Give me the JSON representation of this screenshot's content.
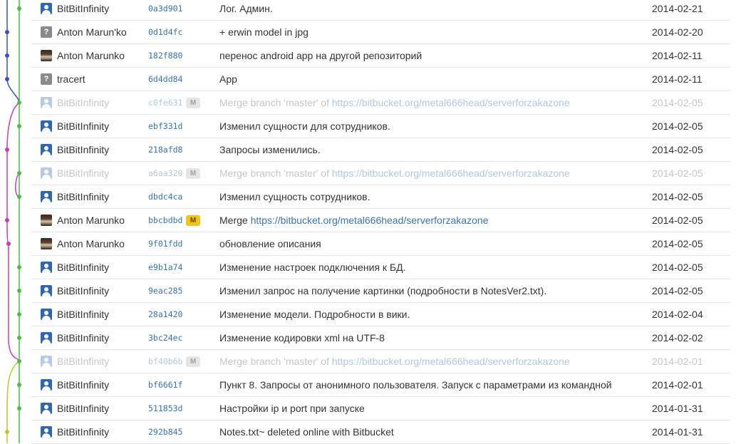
{
  "graph": {
    "colors": {
      "green": "#49bf4a",
      "blue": "#3a4fc1",
      "magenta": "#c23fb8",
      "olive": "#c4c43a"
    }
  },
  "commits": [
    {
      "avatar": "person",
      "author": "BitBitInfinity",
      "hash": "0a3d901",
      "message": "Лог. Админ.",
      "date": "2014-02-21"
    },
    {
      "avatar": "unknown",
      "author": "Anton Marun'ko",
      "hash": "0d1d4fc",
      "message": "+ erwin model in jpg",
      "date": "2014-02-20"
    },
    {
      "avatar": "photo",
      "author": "Anton Marunko",
      "hash": "182f880",
      "message": "перенос android app на другой репозиторий",
      "date": "2014-02-11"
    },
    {
      "avatar": "unknown",
      "author": "tracert",
      "hash": "6d4dd84",
      "message": "App",
      "date": "2014-02-11"
    },
    {
      "avatar": "person",
      "author": "BitBitInfinity",
      "hash": "c0fe631",
      "badge": "M",
      "message": "Merge branch 'master' of ",
      "link": "https://bitbucket.org/metal666head/serverforzakazone",
      "date": "2014-02-05",
      "muted": true
    },
    {
      "avatar": "person",
      "author": "BitBitInfinity",
      "hash": "ebf331d",
      "message": "Изменил сущности для сотрудников.",
      "date": "2014-02-05"
    },
    {
      "avatar": "person",
      "author": "BitBitInfinity",
      "hash": "218afd8",
      "message": "Запросы изменились.",
      "date": "2014-02-05"
    },
    {
      "avatar": "person",
      "author": "BitBitInfinity",
      "hash": "a6aa320",
      "badge": "M",
      "message": "Merge branch 'master' of ",
      "link": "https://bitbucket.org/metal666head/serverforzakazone",
      "date": "2014-02-05",
      "muted": true
    },
    {
      "avatar": "person",
      "author": "BitBitInfinity",
      "hash": "dbdc4ca",
      "message": "Изменил сущность сотрудников.",
      "date": "2014-02-05"
    },
    {
      "avatar": "photo",
      "author": "Anton Marunko",
      "hash": "bbcbdbd",
      "badge": "M",
      "badge_style": "yellow",
      "message": "Merge ",
      "link": "https://bitbucket.org/metal666head/serverforzakazone",
      "date": "2014-02-05"
    },
    {
      "avatar": "photo",
      "author": "Anton Marunko",
      "hash": "9f01fdd",
      "message": "обновление описания",
      "date": "2014-02-05"
    },
    {
      "avatar": "person",
      "author": "BitBitInfinity",
      "hash": "e9b1a74",
      "message": "Изменение настроек подключения к БД.",
      "date": "2014-02-05"
    },
    {
      "avatar": "person",
      "author": "BitBitInfinity",
      "hash": "9eac285",
      "message": "Изменил запрос на получение картинки (подробности в NotesVer2.txt).",
      "date": "2014-02-05"
    },
    {
      "avatar": "person",
      "author": "BitBitInfinity",
      "hash": "28a1420",
      "message": "Изменение модели. Подробности в вики.",
      "date": "2014-02-04"
    },
    {
      "avatar": "person",
      "author": "BitBitInfinity",
      "hash": "3bc24ec",
      "message": "Изменение кодировки xml на UTF-8",
      "date": "2014-02-02"
    },
    {
      "avatar": "person",
      "author": "BitBitInfinity",
      "hash": "bf40b6b",
      "badge": "M",
      "message": "Merge branch 'master' of ",
      "link": "https://bitbucket.org/metal666head/serverforzakazone",
      "date": "2014-02-01",
      "muted": true
    },
    {
      "avatar": "person",
      "author": "BitBitInfinity",
      "hash": "bf6661f",
      "message": "Пункт 8. Запросы от анонимного пользователя. Запуск с параметрами из командной",
      "date": "2014-02-01"
    },
    {
      "avatar": "person",
      "author": "BitBitInfinity",
      "hash": "511853d",
      "message": "Настройки ip и port при запуске",
      "date": "2014-01-31"
    },
    {
      "avatar": "person",
      "author": "BitBitInfinity",
      "hash": "292b845",
      "message": "Notes.txt~ deleted online with Bitbucket",
      "date": "2014-01-31"
    }
  ]
}
